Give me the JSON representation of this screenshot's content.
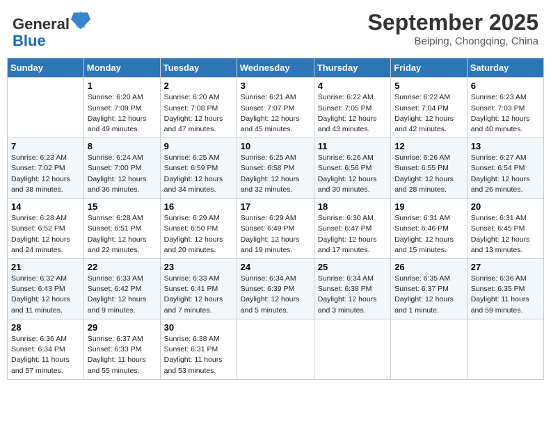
{
  "header": {
    "logo_line1": "General",
    "logo_line2": "Blue",
    "month_title": "September 2025",
    "subtitle": "Beiping, Chongqing, China"
  },
  "weekdays": [
    "Sunday",
    "Monday",
    "Tuesday",
    "Wednesday",
    "Thursday",
    "Friday",
    "Saturday"
  ],
  "weeks": [
    [
      {
        "day": "",
        "sunrise": "",
        "sunset": "",
        "daylight": ""
      },
      {
        "day": "1",
        "sunrise": "Sunrise: 6:20 AM",
        "sunset": "Sunset: 7:09 PM",
        "daylight": "Daylight: 12 hours and 49 minutes."
      },
      {
        "day": "2",
        "sunrise": "Sunrise: 6:20 AM",
        "sunset": "Sunset: 7:08 PM",
        "daylight": "Daylight: 12 hours and 47 minutes."
      },
      {
        "day": "3",
        "sunrise": "Sunrise: 6:21 AM",
        "sunset": "Sunset: 7:07 PM",
        "daylight": "Daylight: 12 hours and 45 minutes."
      },
      {
        "day": "4",
        "sunrise": "Sunrise: 6:22 AM",
        "sunset": "Sunset: 7:05 PM",
        "daylight": "Daylight: 12 hours and 43 minutes."
      },
      {
        "day": "5",
        "sunrise": "Sunrise: 6:22 AM",
        "sunset": "Sunset: 7:04 PM",
        "daylight": "Daylight: 12 hours and 42 minutes."
      },
      {
        "day": "6",
        "sunrise": "Sunrise: 6:23 AM",
        "sunset": "Sunset: 7:03 PM",
        "daylight": "Daylight: 12 hours and 40 minutes."
      }
    ],
    [
      {
        "day": "7",
        "sunrise": "Sunrise: 6:23 AM",
        "sunset": "Sunset: 7:02 PM",
        "daylight": "Daylight: 12 hours and 38 minutes."
      },
      {
        "day": "8",
        "sunrise": "Sunrise: 6:24 AM",
        "sunset": "Sunset: 7:00 PM",
        "daylight": "Daylight: 12 hours and 36 minutes."
      },
      {
        "day": "9",
        "sunrise": "Sunrise: 6:25 AM",
        "sunset": "Sunset: 6:59 PM",
        "daylight": "Daylight: 12 hours and 34 minutes."
      },
      {
        "day": "10",
        "sunrise": "Sunrise: 6:25 AM",
        "sunset": "Sunset: 6:58 PM",
        "daylight": "Daylight: 12 hours and 32 minutes."
      },
      {
        "day": "11",
        "sunrise": "Sunrise: 6:26 AM",
        "sunset": "Sunset: 6:56 PM",
        "daylight": "Daylight: 12 hours and 30 minutes."
      },
      {
        "day": "12",
        "sunrise": "Sunrise: 6:26 AM",
        "sunset": "Sunset: 6:55 PM",
        "daylight": "Daylight: 12 hours and 28 minutes."
      },
      {
        "day": "13",
        "sunrise": "Sunrise: 6:27 AM",
        "sunset": "Sunset: 6:54 PM",
        "daylight": "Daylight: 12 hours and 26 minutes."
      }
    ],
    [
      {
        "day": "14",
        "sunrise": "Sunrise: 6:28 AM",
        "sunset": "Sunset: 6:52 PM",
        "daylight": "Daylight: 12 hours and 24 minutes."
      },
      {
        "day": "15",
        "sunrise": "Sunrise: 6:28 AM",
        "sunset": "Sunset: 6:51 PM",
        "daylight": "Daylight: 12 hours and 22 minutes."
      },
      {
        "day": "16",
        "sunrise": "Sunrise: 6:29 AM",
        "sunset": "Sunset: 6:50 PM",
        "daylight": "Daylight: 12 hours and 20 minutes."
      },
      {
        "day": "17",
        "sunrise": "Sunrise: 6:29 AM",
        "sunset": "Sunset: 6:49 PM",
        "daylight": "Daylight: 12 hours and 19 minutes."
      },
      {
        "day": "18",
        "sunrise": "Sunrise: 6:30 AM",
        "sunset": "Sunset: 6:47 PM",
        "daylight": "Daylight: 12 hours and 17 minutes."
      },
      {
        "day": "19",
        "sunrise": "Sunrise: 6:31 AM",
        "sunset": "Sunset: 6:46 PM",
        "daylight": "Daylight: 12 hours and 15 minutes."
      },
      {
        "day": "20",
        "sunrise": "Sunrise: 6:31 AM",
        "sunset": "Sunset: 6:45 PM",
        "daylight": "Daylight: 12 hours and 13 minutes."
      }
    ],
    [
      {
        "day": "21",
        "sunrise": "Sunrise: 6:32 AM",
        "sunset": "Sunset: 6:43 PM",
        "daylight": "Daylight: 12 hours and 11 minutes."
      },
      {
        "day": "22",
        "sunrise": "Sunrise: 6:33 AM",
        "sunset": "Sunset: 6:42 PM",
        "daylight": "Daylight: 12 hours and 9 minutes."
      },
      {
        "day": "23",
        "sunrise": "Sunrise: 6:33 AM",
        "sunset": "Sunset: 6:41 PM",
        "daylight": "Daylight: 12 hours and 7 minutes."
      },
      {
        "day": "24",
        "sunrise": "Sunrise: 6:34 AM",
        "sunset": "Sunset: 6:39 PM",
        "daylight": "Daylight: 12 hours and 5 minutes."
      },
      {
        "day": "25",
        "sunrise": "Sunrise: 6:34 AM",
        "sunset": "Sunset: 6:38 PM",
        "daylight": "Daylight: 12 hours and 3 minutes."
      },
      {
        "day": "26",
        "sunrise": "Sunrise: 6:35 AM",
        "sunset": "Sunset: 6:37 PM",
        "daylight": "Daylight: 12 hours and 1 minute."
      },
      {
        "day": "27",
        "sunrise": "Sunrise: 6:36 AM",
        "sunset": "Sunset: 6:35 PM",
        "daylight": "Daylight: 11 hours and 59 minutes."
      }
    ],
    [
      {
        "day": "28",
        "sunrise": "Sunrise: 6:36 AM",
        "sunset": "Sunset: 6:34 PM",
        "daylight": "Daylight: 11 hours and 57 minutes."
      },
      {
        "day": "29",
        "sunrise": "Sunrise: 6:37 AM",
        "sunset": "Sunset: 6:33 PM",
        "daylight": "Daylight: 11 hours and 55 minutes."
      },
      {
        "day": "30",
        "sunrise": "Sunrise: 6:38 AM",
        "sunset": "Sunset: 6:31 PM",
        "daylight": "Daylight: 11 hours and 53 minutes."
      },
      {
        "day": "",
        "sunrise": "",
        "sunset": "",
        "daylight": ""
      },
      {
        "day": "",
        "sunrise": "",
        "sunset": "",
        "daylight": ""
      },
      {
        "day": "",
        "sunrise": "",
        "sunset": "",
        "daylight": ""
      },
      {
        "day": "",
        "sunrise": "",
        "sunset": "",
        "daylight": ""
      }
    ]
  ]
}
